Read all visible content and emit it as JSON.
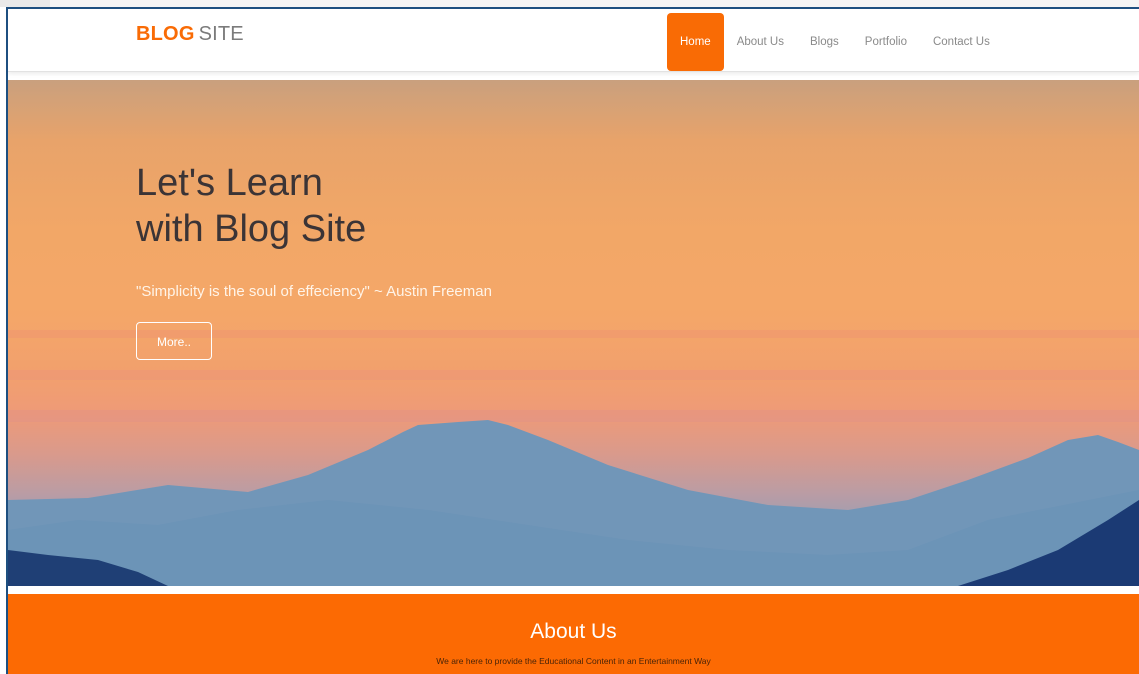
{
  "logo": {
    "bold": "BLOG",
    "light": "SITE"
  },
  "nav": {
    "items": [
      {
        "label": "Home",
        "active": true
      },
      {
        "label": "About Us",
        "active": false
      },
      {
        "label": "Blogs",
        "active": false
      },
      {
        "label": "Portfolio",
        "active": false
      },
      {
        "label": "Contact Us",
        "active": false
      }
    ]
  },
  "hero": {
    "title_line1": "Let's Learn",
    "title_line2": "with Blog Site",
    "quote": "\"Simplicity is the soul of effeciency\" ~ Austin Freeman",
    "button_label": "More.."
  },
  "about": {
    "title": "About Us",
    "text": "We are here to provide the Educational Content in an Entertainment Way"
  },
  "colors": {
    "accent": "#f96b05",
    "about_bg": "#fc6a03",
    "frame_border": "#1d4f80"
  }
}
